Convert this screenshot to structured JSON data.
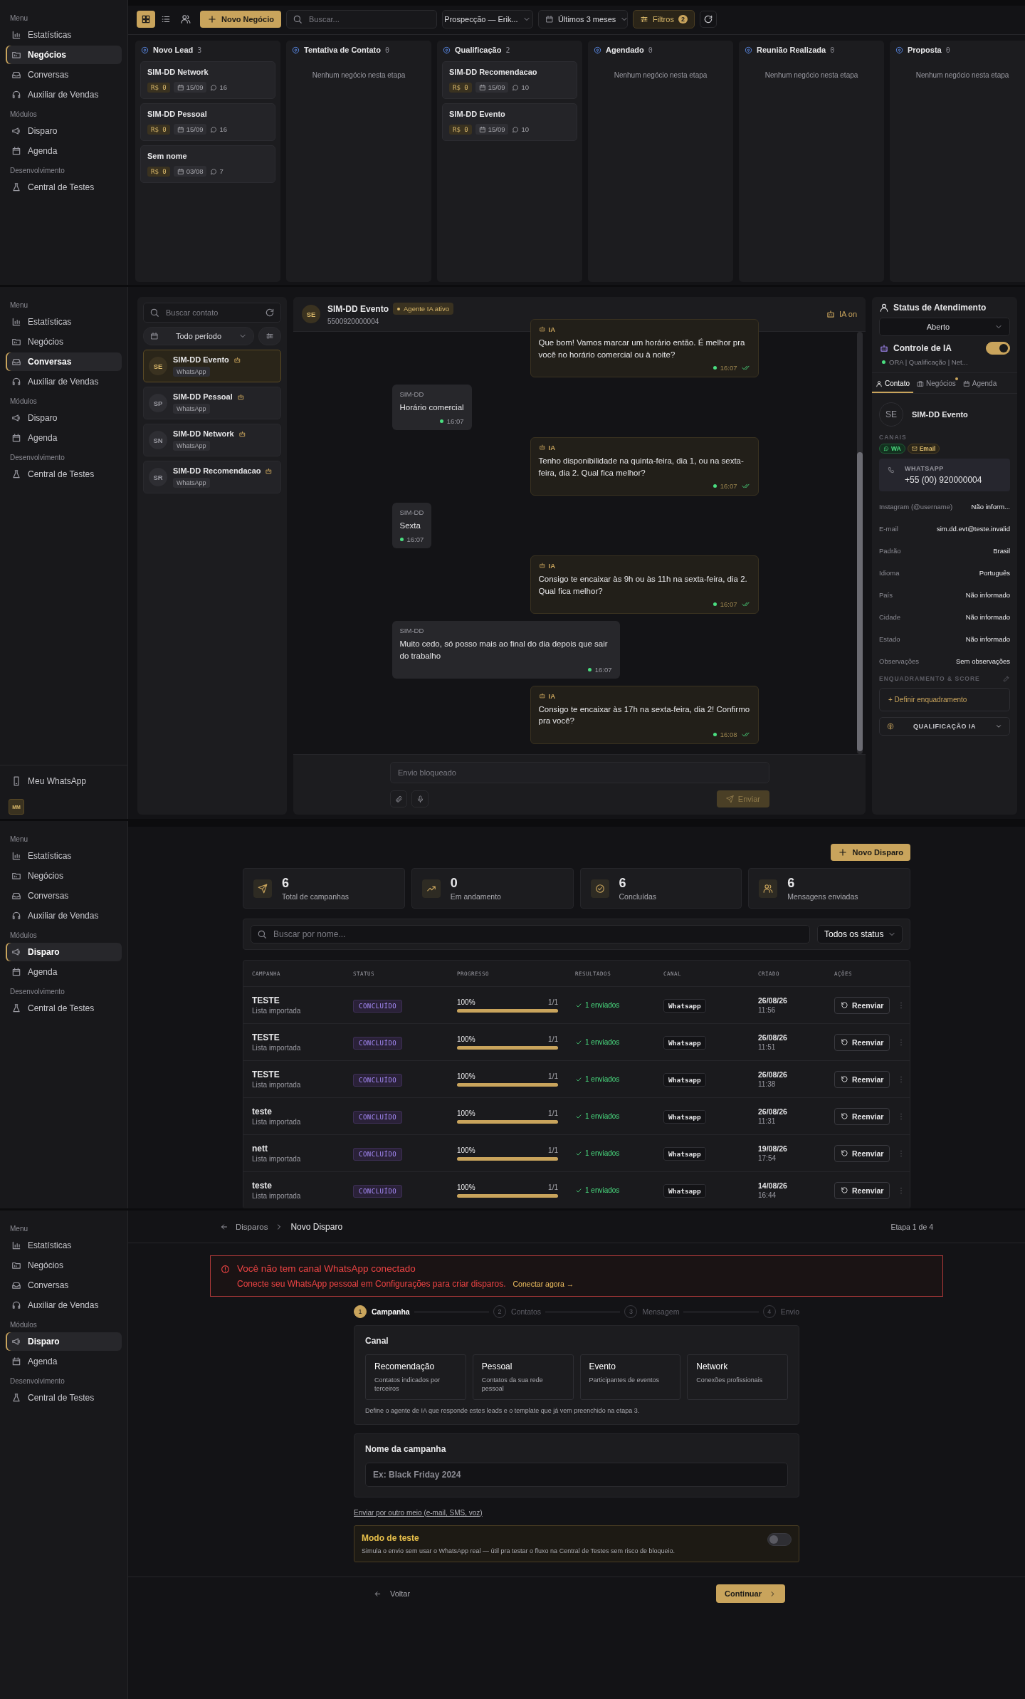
{
  "screens": [
    {
      "kind": "kanban",
      "sidebar": {
        "sections": [
          {
            "title": "Menu",
            "items": [
              {
                "label": "Estatísticas",
                "selected": false
              },
              {
                "label": "Negócios",
                "selected": true
              },
              {
                "label": "Conversas",
                "selected": false
              },
              {
                "label": "Auxiliar de Vendas",
                "selected": false
              }
            ]
          },
          {
            "title": "Módulos",
            "items": [
              {
                "label": "Disparo",
                "selected": false
              },
              {
                "label": "Agenda",
                "selected": false
              }
            ]
          },
          {
            "title": "Desenvolvimento",
            "items": [
              {
                "label": "Central de Testes",
                "selected": false
              }
            ]
          }
        ]
      },
      "toolbar": {
        "view_modes": [
          {
            "selected": true
          },
          {
            "selected": false
          },
          {
            "selected": false
          }
        ],
        "new_button": "Novo Negócio",
        "search": {
          "placeholder": "Buscar..."
        },
        "pipeline": "Prospecção — Erik...",
        "period": "Últimos 3 meses",
        "filters": {
          "label": "Filtros",
          "count": "2"
        }
      },
      "columns": [
        {
          "title": "Novo Lead",
          "count": "3",
          "cards": [
            {
              "name": "SIM-DD Network",
              "value": "R$ 0",
              "date": "15/09",
              "messages": "16"
            },
            {
              "name": "SIM-DD Pessoal",
              "value": "R$ 0",
              "date": "15/09",
              "messages": "16"
            },
            {
              "name": "Sem nome",
              "value": "R$ 0",
              "date": "03/08",
              "messages": "7"
            }
          ]
        },
        {
          "title": "Tentativa de Contato",
          "count": "0",
          "empty_text": "Nenhum negócio nesta etapa"
        },
        {
          "title": "Qualificação",
          "count": "2",
          "cards": [
            {
              "name": "SIM-DD Recomendacao",
              "value": "R$ 0",
              "date": "15/09",
              "messages": "10"
            },
            {
              "name": "SIM-DD Evento",
              "value": "R$ 0",
              "date": "15/09",
              "messages": "10"
            }
          ]
        },
        {
          "title": "Agendado",
          "count": "0",
          "empty_text": "Nenhum negócio nesta etapa"
        },
        {
          "title": "Reunião Realizada",
          "count": "0",
          "empty_text": "Nenhum negócio nesta etapa"
        },
        {
          "title": "Proposta",
          "count": "0",
          "empty_text": "Nenhum negócio nesta etapa"
        }
      ]
    },
    {
      "kind": "chat",
      "sidebar": {
        "sections": [
          {
            "title": "Menu",
            "items": [
              {
                "label": "Estatísticas",
                "selected": false
              },
              {
                "label": "Negócios",
                "selected": false
              },
              {
                "label": "Conversas",
                "selected": true
              },
              {
                "label": "Auxiliar de Vendas",
                "selected": false
              }
            ]
          },
          {
            "title": "Módulos",
            "items": [
              {
                "label": "Disparo",
                "selected": false
              },
              {
                "label": "Agenda",
                "selected": false
              }
            ]
          },
          {
            "title": "Desenvolvimento",
            "items": [
              {
                "label": "Central de Testes",
                "selected": false
              }
            ]
          }
        ],
        "footer": {
          "label": "Meu WhatsApp",
          "avatar": "MM"
        }
      },
      "contacts_panel": {
        "search": {
          "placeholder": "Buscar contato"
        },
        "period": "Todo período",
        "contacts": [
          {
            "initials": "SE",
            "name": "SIM-DD Evento",
            "channel": "WhatsApp",
            "selected": true
          },
          {
            "initials": "SP",
            "name": "SIM-DD Pessoal",
            "channel": "WhatsApp",
            "selected": false
          },
          {
            "initials": "SN",
            "name": "SIM-DD Network",
            "channel": "WhatsApp",
            "selected": false
          },
          {
            "initials": "SR",
            "name": "SIM-DD Recomendacao",
            "channel": "WhatsApp",
            "selected": false
          }
        ]
      },
      "conversation": {
        "contact": {
          "initials": "SE",
          "name": "SIM-DD Evento",
          "phone": "5500920000004",
          "badge": "Agente IA ativo"
        },
        "ai_status": "IA on",
        "messages": [
          {
            "kind": "ai",
            "sender": "IA",
            "text": "Que bom! Vamos marcar um horário então. É melhor pra você no horário comercial ou à noite?",
            "time": "16:07"
          },
          {
            "kind": "contact",
            "sender": "SIM-DD",
            "text": "Horário comercial",
            "time": "16:07"
          },
          {
            "kind": "ai",
            "sender": "IA",
            "text": "Tenho disponibilidade na quinta-feira, dia 1, ou na sexta-feira, dia 2. Qual fica melhor?",
            "time": "16:07"
          },
          {
            "kind": "contact",
            "sender": "SIM-DD",
            "text": "Sexta",
            "time": "16:07"
          },
          {
            "kind": "ai",
            "sender": "IA",
            "text": "Consigo te encaixar às 9h ou às 11h na sexta-feira, dia 2. Qual fica melhor?",
            "time": "16:07"
          },
          {
            "kind": "contact",
            "sender": "SIM-DD",
            "text": "Muito cedo, só posso mais ao final do dia depois que sair do trabalho",
            "time": "16:07"
          },
          {
            "kind": "ai",
            "sender": "IA",
            "text": "Consigo te encaixar às 17h na sexta-feira, dia 2! Confirmo pra você?",
            "time": "16:08"
          }
        ],
        "composer": {
          "placeholder": "Envio bloqueado",
          "send": "Enviar",
          "disabled": true
        }
      },
      "details": {
        "status": {
          "title": "Status de Atendimento",
          "value": "Aberto"
        },
        "ai_control": {
          "label": "Controle de IA",
          "on": true,
          "summary": "ORA | Qualificação | Net..."
        },
        "tabs": [
          {
            "label": "Contato",
            "selected": true,
            "notification": false
          },
          {
            "label": "Negócios",
            "selected": false,
            "notification": true
          },
          {
            "label": "Agenda",
            "selected": false,
            "notification": false
          }
        ],
        "contact": {
          "initials": "SE",
          "name": "SIM-DD Evento"
        },
        "channels_label": "CANAIS",
        "channels": [
          {
            "kind": "whatsapp",
            "label": "WA"
          },
          {
            "kind": "email",
            "label": "Email"
          }
        ],
        "whatsapp": {
          "label": "WHATSAPP",
          "value": "+55 (00) 920000004"
        },
        "fields": [
          {
            "label": "Instagram (@username)",
            "value": "Não inform..."
          },
          {
            "label": "E-mail",
            "value": "sim.dd.evt@teste.invalid"
          },
          {
            "label": "Padrão",
            "value": "Brasil"
          },
          {
            "label": "Idioma",
            "value": "Português"
          },
          {
            "label": "País",
            "value": "Não informado"
          },
          {
            "label": "Cidade",
            "value": "Não informado"
          },
          {
            "label": "Estado",
            "value": "Não informado"
          },
          {
            "label": "Observações",
            "value": "Sem observações"
          }
        ],
        "score": {
          "title": "ENQUADRAMENTO & SCORE",
          "action": "+ Definir enquadramento"
        },
        "qualification": {
          "label": "QUALIFICAÇÃO IA",
          "expanded": false
        }
      }
    },
    {
      "kind": "campaigns",
      "sidebar": {
        "sections": [
          {
            "title": "Menu",
            "items": [
              {
                "label": "Estatísticas",
                "selected": false
              },
              {
                "label": "Negócios",
                "selected": false
              },
              {
                "label": "Conversas",
                "selected": false
              },
              {
                "label": "Auxiliar de Vendas",
                "selected": false
              }
            ]
          },
          {
            "title": "Módulos",
            "items": [
              {
                "label": "Disparo",
                "selected": true
              },
              {
                "label": "Agenda",
                "selected": false
              }
            ]
          },
          {
            "title": "Desenvolvimento",
            "items": [
              {
                "label": "Central de Testes",
                "selected": false
              }
            ]
          }
        ]
      },
      "new_button": "Novo Disparo",
      "stats": [
        {
          "value": "6",
          "label": "Total de campanhas"
        },
        {
          "value": "0",
          "label": "Em andamento"
        },
        {
          "value": "6",
          "label": "Concluídas"
        },
        {
          "value": "6",
          "label": "Mensagens enviadas"
        }
      ],
      "search": {
        "placeholder": "Buscar por nome..."
      },
      "status_filter": "Todos os status",
      "table": {
        "columns": [
          "CAMPANHA",
          "STATUS",
          "PROGRESSO",
          "RESULTADOS",
          "CANAL",
          "CRIADO",
          "AÇÕES"
        ],
        "rows": [
          {
            "name": "TESTE",
            "source": "Lista importada",
            "status": "CONCLUÍDO",
            "percent": "100%",
            "level": 1,
            "count": "1/1",
            "result": "1 enviados",
            "channel": "Whatsapp",
            "date": "26/08/26",
            "time": "11:56",
            "action": "Reenviar"
          },
          {
            "name": "TESTE",
            "source": "Lista importada",
            "status": "CONCLUÍDO",
            "percent": "100%",
            "level": 1,
            "count": "1/1",
            "result": "1 enviados",
            "channel": "Whatsapp",
            "date": "26/08/26",
            "time": "11:51",
            "action": "Reenviar"
          },
          {
            "name": "TESTE",
            "source": "Lista importada",
            "status": "CONCLUÍDO",
            "percent": "100%",
            "level": 1,
            "count": "1/1",
            "result": "1 enviados",
            "channel": "Whatsapp",
            "date": "26/08/26",
            "time": "11:38",
            "action": "Reenviar"
          },
          {
            "name": "teste",
            "source": "Lista importada",
            "status": "CONCLUÍDO",
            "percent": "100%",
            "level": 1,
            "count": "1/1",
            "result": "1 enviados",
            "channel": "Whatsapp",
            "date": "26/08/26",
            "time": "11:31",
            "action": "Reenviar"
          },
          {
            "name": "nett",
            "source": "Lista importada",
            "status": "CONCLUÍDO",
            "percent": "100%",
            "level": 1,
            "count": "1/1",
            "result": "1 enviados",
            "channel": "Whatsapp",
            "date": "19/08/26",
            "time": "17:54",
            "action": "Reenviar"
          },
          {
            "name": "teste",
            "source": "Lista importada",
            "status": "CONCLUÍDO",
            "percent": "100%",
            "level": 1,
            "count": "1/1",
            "result": "1 enviados",
            "channel": "Whatsapp",
            "date": "14/08/26",
            "time": "16:44",
            "action": "Reenviar"
          }
        ]
      }
    },
    {
      "kind": "new_campaign",
      "sidebar": {
        "sections": [
          {
            "title": "Menu",
            "items": [
              {
                "label": "Estatísticas",
                "selected": false
              },
              {
                "label": "Negócios",
                "selected": false
              },
              {
                "label": "Conversas",
                "selected": false
              },
              {
                "label": "Auxiliar de Vendas",
                "selected": false
              }
            ]
          },
          {
            "title": "Módulos",
            "items": [
              {
                "label": "Disparo",
                "selected": true
              },
              {
                "label": "Agenda",
                "selected": false
              }
            ]
          },
          {
            "title": "Desenvolvimento",
            "items": [
              {
                "label": "Central de Testes",
                "selected": false
              }
            ]
          }
        ]
      },
      "breadcrumb": {
        "parent": "Disparos",
        "current": "Novo Disparo"
      },
      "step_counter": "Etapa 1 de 4",
      "alert": {
        "title": "Você não tem canal WhatsApp conectado",
        "text": "Conecte seu WhatsApp pessoal em Configurações para criar disparos.",
        "link": "Conectar agora →"
      },
      "steps": [
        {
          "number": "1",
          "label": "Campanha",
          "selected": true
        },
        {
          "number": "2",
          "label": "Contatos",
          "selected": false
        },
        {
          "number": "3",
          "label": "Mensagem",
          "selected": false
        },
        {
          "number": "4",
          "label": "Envio",
          "selected": false
        }
      ],
      "channel_card": {
        "title": "Canal",
        "options": [
          {
            "title": "Recomendação",
            "description": "Contatos indicados por terceiros"
          },
          {
            "title": "Pessoal",
            "description": "Contatos da sua rede pessoal"
          },
          {
            "title": "Evento",
            "description": "Participantes de eventos"
          },
          {
            "title": "Network",
            "description": "Conexões profissionais"
          }
        ],
        "note": "Define o agente de IA que responde estes leads e o template que já vem preenchido na etapa 3."
      },
      "name_card": {
        "title": "Nome da campanha",
        "placeholder": "Ex: Black Friday 2024"
      },
      "alt_link": "Enviar por outro meio (e-mail, SMS, voz)",
      "test_mode": {
        "title": "Modo de teste",
        "description": "Simula o envio sem usar o WhatsApp real — útil pra testar o fluxo na Central de Testes sem risco de bloqueio.",
        "on": false
      },
      "back": "Voltar",
      "next": "Continuar"
    }
  ]
}
